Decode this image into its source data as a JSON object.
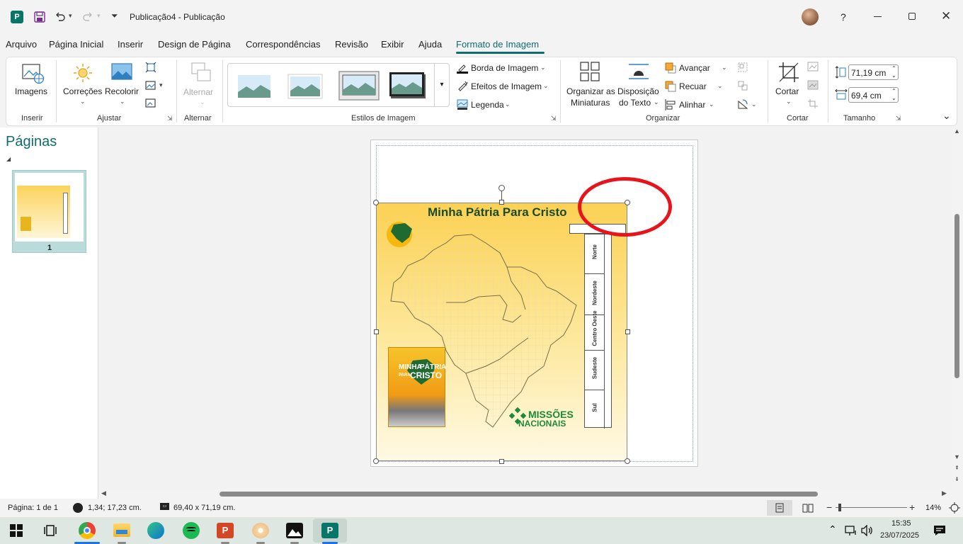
{
  "window": {
    "title": "Publicação4  -  Publicação",
    "help": "?"
  },
  "menu": [
    "Arquivo",
    "Página Inicial",
    "Inserir",
    "Design de Página",
    "Correspondências",
    "Revisão",
    "Exibir",
    "Ajuda",
    "Formato de Imagem"
  ],
  "ribbon": {
    "inserir": {
      "imagens": "Imagens",
      "group": "Inserir"
    },
    "ajustar": {
      "correcoes": "Correções",
      "recolorir": "Recolorir",
      "group": "Ajustar"
    },
    "alternar": {
      "alternar": "Alternar",
      "group": "Alternar"
    },
    "estilos": {
      "group": "Estilos de Imagem",
      "borda": "Borda de Imagem",
      "efeitos": "Efeitos de Imagem",
      "legenda": "Legenda"
    },
    "organizar": {
      "miniaturas_1": "Organizar as",
      "miniaturas_2": "Miniaturas",
      "disposicao_1": "Disposição",
      "disposicao_2": "do Texto",
      "avancar": "Avançar",
      "recuar": "Recuar",
      "alinhar": "Alinhar",
      "group": "Organizar"
    },
    "cortar": {
      "cortar": "Cortar",
      "group": "Cortar"
    },
    "tamanho": {
      "altura": "71,19 cm",
      "largura": "69,4 cm",
      "group": "Tamanho"
    }
  },
  "pages_panel": {
    "title": "Páginas",
    "page_number": "1"
  },
  "poster": {
    "title": "Minha Pátria Para Cristo",
    "regions": [
      "Norte",
      "Nordeste",
      "Centro Oeste",
      "Sudeste",
      "Sul"
    ],
    "logo_text_1": "MISSÕES",
    "logo_text_2": "NACIONAIS",
    "badge_1": "MINHA",
    "badge_2": "PÁTRIA",
    "badge_3": "PARA",
    "badge_4": "CRISTO"
  },
  "status": {
    "page": "Página: 1 de 1",
    "position": "1,34; 17,23 cm.",
    "size": "69,40 x  71,19 cm.",
    "zoom": "14%"
  },
  "taskbar": {
    "time": "15:35",
    "date": "23/07/2025"
  },
  "colors": {
    "accent": "#0f6c70",
    "red_circle": "#e8141c",
    "publisher": "#077568"
  }
}
